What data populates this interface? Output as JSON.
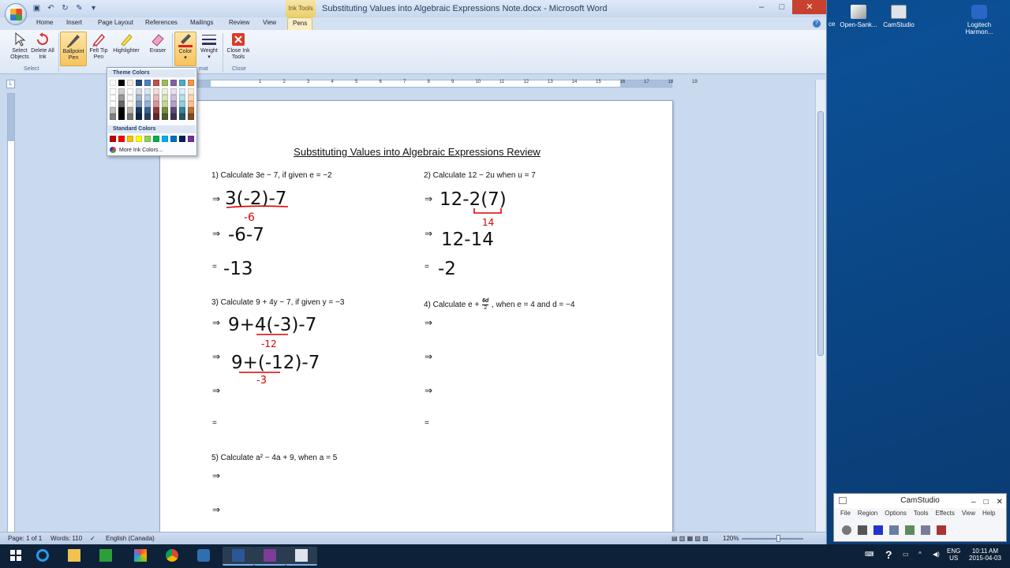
{
  "window": {
    "title": "Substituting Values into Algebraic Expressions Note.docx - Microsoft Word",
    "context_tab": "Ink Tools"
  },
  "tabs": [
    "Home",
    "Insert",
    "Page Layout",
    "References",
    "Mailings",
    "Review",
    "View",
    "Pens"
  ],
  "active_tab": "Pens",
  "ribbon": {
    "select_objects": "Select Objects",
    "delete_all_ink": "Delete All Ink",
    "ballpoint_pen": "Ballpoint Pen",
    "felt_tip_pen": "Felt Tip Pen",
    "highlighter": "Highlighter",
    "eraser": "Eraser",
    "color": "Color",
    "weight": "Weight",
    "close_ink_tools": "Close Ink Tools",
    "group_select": "Select",
    "group_format": "mat",
    "group_close": "Close"
  },
  "color_dropdown": {
    "theme_header": "Theme Colors",
    "standard_header": "Standard Colors",
    "more": "More Ink Colors...",
    "theme_colors": [
      "#ffffff",
      "#000000",
      "#eeece1",
      "#1f497d",
      "#4f81bd",
      "#c0504d",
      "#9bbb59",
      "#8064a2",
      "#4bacc6",
      "#f79646"
    ],
    "standard_colors": [
      "#c00000",
      "#ff0000",
      "#ffc000",
      "#ffff00",
      "#92d050",
      "#00b050",
      "#00b0f0",
      "#0070c0",
      "#002060",
      "#7030a0"
    ]
  },
  "ruler_marks": [
    "1",
    "2",
    "3",
    "4",
    "5",
    "6",
    "7",
    "8",
    "9",
    "10",
    "11",
    "12",
    "13",
    "14",
    "15",
    "16",
    "17",
    "18",
    "19"
  ],
  "document": {
    "title": "Substituting Values into Algebraic Expressions Review",
    "arrow": "⇒",
    "equals": "=",
    "questions": {
      "q1": "1)  Calculate 3e − 7, if given e = −2",
      "q2": "2)  Calculate 12 − 2u when u = 7",
      "q3": "3)  Calculate 9 + 4y − 7, if given y = −3",
      "q4_pre": "4)  Calculate e +",
      "q4_num": "6d",
      "q4_den": "2",
      "q4_post": ", when e = 4 and d = −4",
      "q5": "5)  Calculate a² − 4a + 9, when a = 5"
    },
    "ink": {
      "q1_l1": "3(-2)-7",
      "q1_sub": "-6",
      "q1_l2": "-6-7",
      "q1_l3": "-13",
      "q2_l1": "12-2(7)",
      "q2_sub": "14",
      "q2_l2": "12-14",
      "q2_l3": "-2",
      "q3_l1": "9+4(-3)-7",
      "q3_sub": "-12",
      "q3_l2": "9+(-12)-7",
      "q3_sub2": "-3"
    }
  },
  "status": {
    "page": "Page: 1 of 1",
    "words": "Words: 110",
    "language": "English (Canada)",
    "zoom": "120%"
  },
  "desktop_icons": [
    "Open-Sank...",
    "CamStudio",
    "Logitech Harmon..."
  ],
  "desktop_partial": "ce",
  "camstudio": {
    "title": "CamStudio",
    "menu": [
      "File",
      "Region",
      "Options",
      "Tools",
      "Effects",
      "View",
      "Help"
    ]
  },
  "tray": {
    "lang": "ENG",
    "region": "US",
    "time": "10:11 AM",
    "date": "2015-04-03"
  }
}
